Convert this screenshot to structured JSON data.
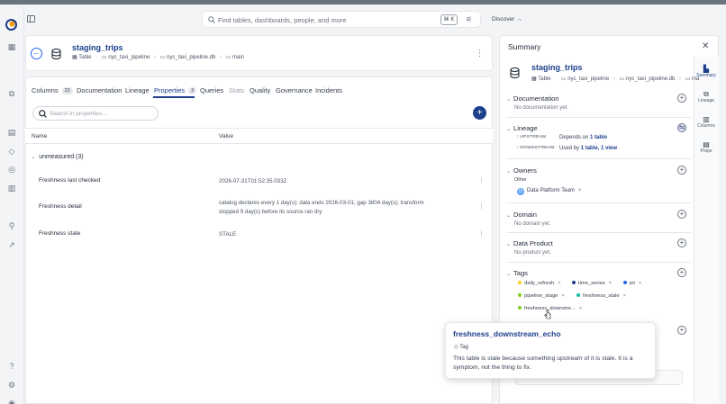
{
  "search": {
    "placeholder": "Find tables, dashboards, people, and more",
    "shortcut": "⌘ K"
  },
  "topnav": {
    "discover": "Discover →"
  },
  "entity": {
    "name": "staging_trips",
    "type": "Table",
    "breadcrumbs": [
      "nyc_taxi_pipeline",
      "nyc_taxi_pipeline.db",
      "main"
    ]
  },
  "tabs": [
    {
      "label": "Columns",
      "count": "22"
    },
    {
      "label": "Documentation",
      "count": ""
    },
    {
      "label": "Lineage",
      "count": ""
    },
    {
      "label": "Properties",
      "count": "3"
    },
    {
      "label": "Queries",
      "count": ""
    },
    {
      "label": "Stats",
      "count": ""
    },
    {
      "label": "Quality",
      "count": ""
    },
    {
      "label": "Governance",
      "count": ""
    },
    {
      "label": "Incidents",
      "count": ""
    }
  ],
  "properties": {
    "search_placeholder": "Search in properties...",
    "columns": {
      "name": "Name",
      "value": "Value"
    },
    "group": "unmeasured (3)",
    "rows": [
      {
        "name": "Freshness last checked",
        "value": "2026-07-31T01:52:35.033Z"
      },
      {
        "name": "Freshness detail",
        "value": "catalog declares every 1 day(s); data ends 2016-03-01; gap 3804 day(s); transform stopped 9 day(s) before its source ran dry"
      },
      {
        "name": "Freshness state",
        "value": "STALE"
      }
    ]
  },
  "summary": {
    "title": "Summary",
    "entity_name": "staging_trips",
    "entity_type": "Table",
    "crumbs": [
      "nyc_taxi_pipeline",
      "nyc_taxi_pipeline.db",
      "ma"
    ],
    "documentation": {
      "label": "Documentation",
      "empty": "No documentation yet."
    },
    "lineage": {
      "label": "Lineage",
      "upstream_label": "UPSTREAM",
      "upstream_pre": "Depends on ",
      "upstream_link": "1 table",
      "downstream_label": "DOWNSTREAM",
      "downstream_pre": "Used by ",
      "downstream_link": "1 table, 1 view"
    },
    "owners": {
      "label": "Owners",
      "type": "Other",
      "owner": "Data Platform Team",
      "owner_initial": "D"
    },
    "domain": {
      "label": "Domain",
      "empty": "No domain yet."
    },
    "data_product": {
      "label": "Data Product",
      "empty": "No product yet."
    },
    "tags": {
      "label": "Tags",
      "items": [
        {
          "name": "daily_refresh",
          "color": "#facc15"
        },
        {
          "name": "time_series",
          "color": "#1e3a8a"
        },
        {
          "name": "pii",
          "color": "#2563eb"
        },
        {
          "name": "pipeline_stage",
          "color": "#84cc16"
        },
        {
          "name": "freshness_stale",
          "color": "#14b8a6"
        },
        {
          "name": "freshness_downstre...",
          "color": "#84cc16"
        }
      ]
    }
  },
  "right_tabs": [
    "Summary",
    "Lineage",
    "Columns",
    "Props"
  ],
  "popup": {
    "title": "freshness_downstream_echo",
    "kind": "Tag",
    "description": "This table is stale because something upstream of it is stale. It is a symptom, not the thing to fix."
  }
}
